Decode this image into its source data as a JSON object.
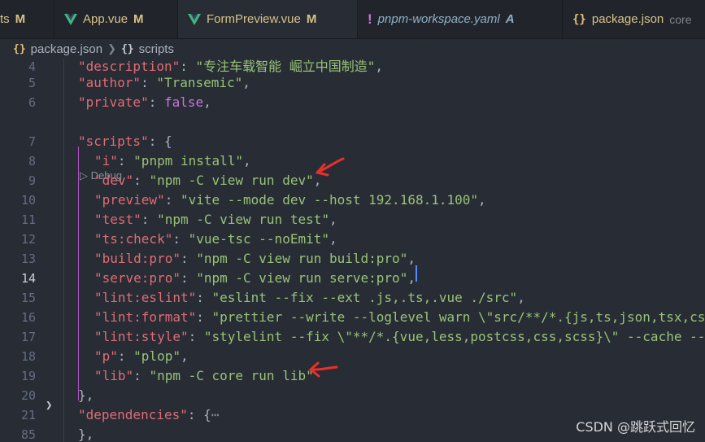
{
  "tabs": [
    {
      "name": "ts",
      "flag": "M"
    },
    {
      "name": "App.vue",
      "flag": "M"
    },
    {
      "name": "FormPreview.vue",
      "flag": "M"
    },
    {
      "name": "pnpm-workspace.yaml",
      "flag": "A"
    },
    {
      "name": "package.json",
      "flag": "core"
    }
  ],
  "breadcrumb": {
    "file": "package.json",
    "section": "scripts"
  },
  "codelens": "Debug",
  "lines": [
    {
      "num": "4",
      "key": "\"description\"",
      "rest": ": \"专注车载智能 崛立中国制造\","
    },
    {
      "num": "5",
      "key": "\"author\"",
      "rest": ": \"Transemic\","
    },
    {
      "num": "6",
      "key": "\"private\"",
      "rest": ": false,"
    },
    {
      "num": "7",
      "key": "\"scripts\"",
      "rest": ": {"
    },
    {
      "num": "8",
      "key": "\"i\"",
      "rest": ": \"pnpm install\","
    },
    {
      "num": "9",
      "key": "\"dev\"",
      "rest": ": \"npm -C view run dev\","
    },
    {
      "num": "10",
      "key": "\"preview\"",
      "rest": ": \"vite --mode dev --host 192.168.1.100\","
    },
    {
      "num": "11",
      "key": "\"test\"",
      "rest": ": \"npm -C view run test\","
    },
    {
      "num": "12",
      "key": "\"ts:check\"",
      "rest": ": \"vue-tsc --noEmit\","
    },
    {
      "num": "13",
      "key": "\"build:pro\"",
      "rest": ": \"npm -C view run build:pro\","
    },
    {
      "num": "14",
      "key": "\"serve:pro\"",
      "rest": ": \"npm -C view run serve:pro\","
    },
    {
      "num": "15",
      "key": "\"lint:eslint\"",
      "rest": ": \"eslint --fix --ext .js,.ts,.vue ./src\","
    },
    {
      "num": "16",
      "key": "\"lint:format\"",
      "rest": ": \"prettier --write --loglevel warn \\\"src/**/*.{js,ts,json,tsx,css"
    },
    {
      "num": "17",
      "key": "\"lint:style\"",
      "rest": ": \"stylelint --fix \\\"**/*.{vue,less,postcss,css,scss}\\\" --cache --c"
    },
    {
      "num": "18",
      "key": "\"p\"",
      "rest": ": \"plop\","
    },
    {
      "num": "19",
      "key": "\"lib\"",
      "rest": ": \"npm -C core run lib\""
    },
    {
      "num": "20",
      "key": "",
      "rest": "},"
    },
    {
      "num": "21",
      "key": "\"dependencies\"",
      "rest": ": {⋯"
    },
    {
      "num": "85",
      "key": "",
      "rest": "},"
    }
  ],
  "watermark": "CSDN @跳跃式回忆",
  "colors": {
    "key": "#e06c75",
    "string": "#98c379",
    "bool": "#c678dd",
    "annotation": "#e8302b"
  }
}
